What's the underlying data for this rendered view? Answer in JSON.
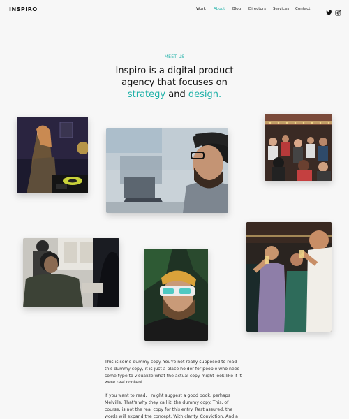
{
  "header": {
    "logo": "INSPIRO",
    "nav": [
      {
        "label": "Work",
        "active": false
      },
      {
        "label": "About",
        "active": true
      },
      {
        "label": "Blog",
        "active": false
      },
      {
        "label": "Directors",
        "active": false
      },
      {
        "label": "Services",
        "active": false
      },
      {
        "label": "Contact",
        "active": false
      }
    ],
    "social": [
      "twitter-icon",
      "instagram-icon"
    ]
  },
  "hero": {
    "eyebrow": "MEET US",
    "line1": "Inspiro is a digital product",
    "line2": "agency that focuses on",
    "accent1": "strategy",
    "connector": " and ",
    "accent2": "design.",
    "accent_color": "#1fb1a8"
  },
  "photos": [
    {
      "name": "dj-photo",
      "subject": "DJ woman at turntables"
    },
    {
      "name": "developer-photo",
      "subject": "Bearded man with glasses at laptop"
    },
    {
      "name": "crowd-photo",
      "subject": "Crowd in a bar"
    },
    {
      "name": "meeting-photo",
      "subject": "People in a meeting room"
    },
    {
      "name": "vr-photo",
      "subject": "Man with beanie wearing VR glasses"
    },
    {
      "name": "party-photo",
      "subject": "Friends toasting drinks at a party"
    }
  ],
  "body": {
    "p1": "This is some dummy copy. You're not really supposed to read this dummy copy, it is just a place holder for people who need some type to visualize what the actual copy might look like if it were real content.",
    "p2": "If you want to read, I might suggest a good book, perhaps Melville. That's why they call it, the dummy copy. This, of course, is not the real copy for this entry. Rest assured, the words will expand the concept. With clarity. Conviction. And a little wit."
  }
}
